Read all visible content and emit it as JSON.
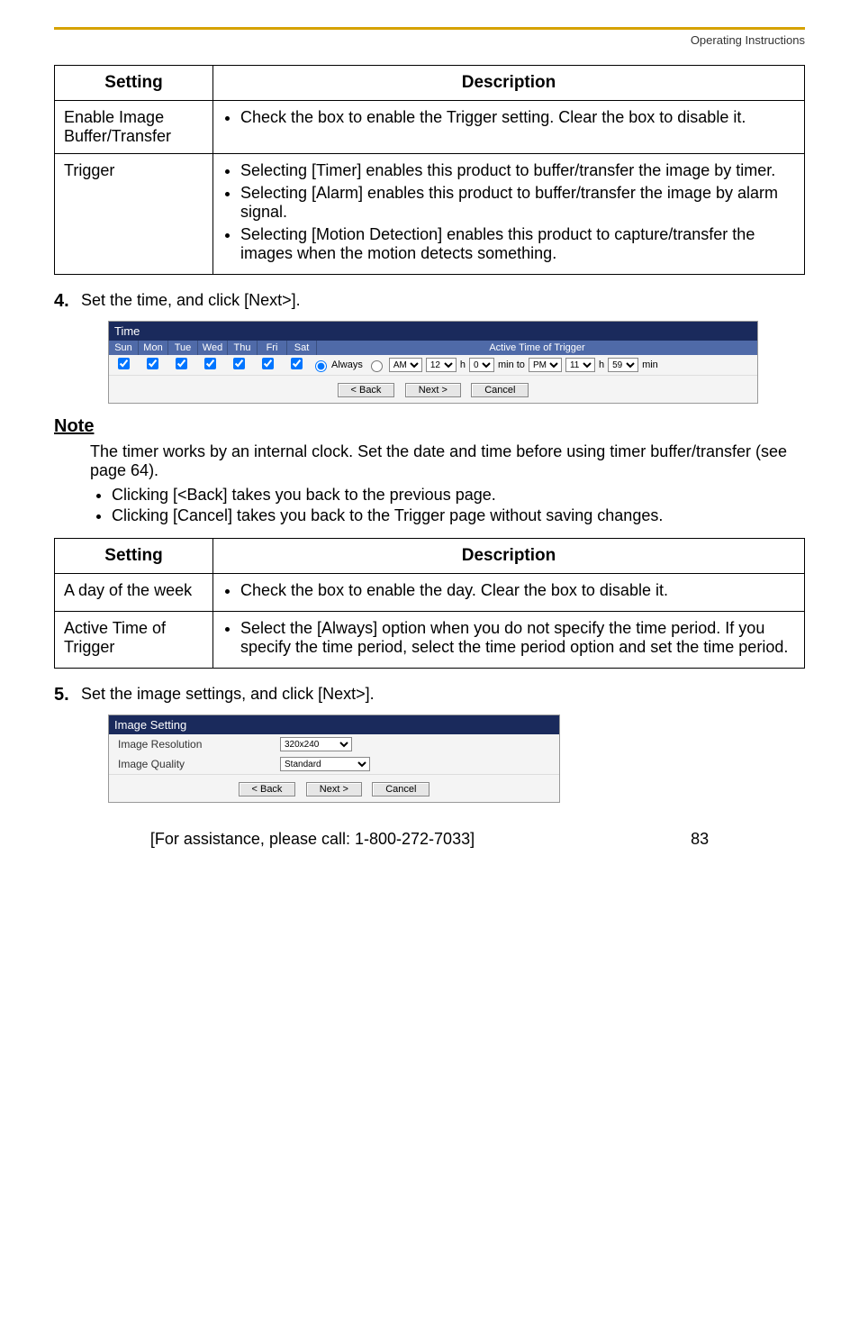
{
  "header": {
    "label": "Operating Instructions"
  },
  "table1": {
    "head": {
      "setting": "Setting",
      "description": "Description"
    },
    "rows": [
      {
        "setting": "Enable Image Buffer/Transfer",
        "bullets": [
          "Check the box to enable the Trigger setting. Clear the box to disable it."
        ]
      },
      {
        "setting": "Trigger",
        "bullets": [
          "Selecting [Timer] enables this product to buffer/transfer the image by timer.",
          "Selecting [Alarm] enables this product to buffer/transfer the image by alarm signal.",
          "Selecting [Motion Detection] enables this product to capture/transfer the images when the motion detects something."
        ]
      }
    ]
  },
  "step4": {
    "num": "4.",
    "text": "Set the time, and click [Next>]."
  },
  "time_panel": {
    "title": "Time",
    "days": [
      "Sun",
      "Mon",
      "Tue",
      "Wed",
      "Thu",
      "Fri",
      "Sat"
    ],
    "active_head": "Active Time of Trigger",
    "always": "Always",
    "ampm1": "AM",
    "h1": "12",
    "m1": "0",
    "minto": "min to",
    "ampm2": "PM",
    "h2": "11",
    "m2": "59",
    "min_lbl": "min",
    "h_lbl": "h",
    "back": "< Back",
    "next": "Next >",
    "cancel": "Cancel"
  },
  "note": {
    "head": "Note",
    "body": "The timer works by an internal clock. Set the date and time before using timer buffer/transfer (see page 64).",
    "bullets": [
      "Clicking [<Back] takes you back to the previous page.",
      "Clicking [Cancel] takes you back to the Trigger page without saving changes."
    ]
  },
  "table2": {
    "head": {
      "setting": "Setting",
      "description": "Description"
    },
    "rows": [
      {
        "setting": "A day of the week",
        "bullets": [
          "Check the box to enable the day. Clear the box to disable it."
        ]
      },
      {
        "setting": "Active Time of Trigger",
        "bullets": [
          "Select the [Always] option when you do not specify the time period. If you specify the time period, select the time period option and set the time period."
        ]
      }
    ]
  },
  "step5": {
    "num": "5.",
    "text": "Set the image settings, and click [Next>]."
  },
  "img_panel": {
    "title": "Image Setting",
    "resolution_lbl": "Image Resolution",
    "resolution_val": "320x240",
    "quality_lbl": "Image Quality",
    "quality_val": "Standard",
    "back": "< Back",
    "next": "Next >",
    "cancel": "Cancel"
  },
  "footer": {
    "assist": "[For assistance, please call: 1-800-272-7033]",
    "page": "83"
  }
}
